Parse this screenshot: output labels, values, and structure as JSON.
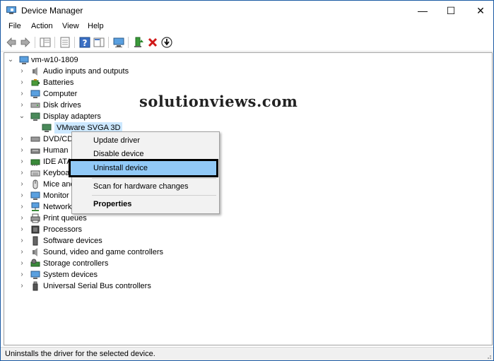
{
  "window": {
    "title": "Device Manager",
    "minimize": "—",
    "maximize": "☐",
    "close": "✕"
  },
  "menu": [
    "File",
    "Action",
    "View",
    "Help"
  ],
  "tree": {
    "root": "vm-w10-1809",
    "items": [
      "Audio inputs and outputs",
      "Batteries",
      "Computer",
      "Disk drives",
      "Display adapters",
      "VMware SVGA 3D",
      "DVD/CD",
      "Human",
      "IDE ATA",
      "Keyboa",
      "Mice and",
      "Monitor",
      "Network",
      "Print queues",
      "Processors",
      "Software devices",
      "Sound, video and game controllers",
      "Storage controllers",
      "System devices",
      "Universal Serial Bus controllers"
    ]
  },
  "context_menu": {
    "items": [
      "Update driver",
      "Disable device",
      "Uninstall device",
      "Scan for hardware changes",
      "Properties"
    ],
    "highlighted": "Uninstall device"
  },
  "watermark": "solutionviews.com",
  "status": "Uninstalls the driver for the selected device.",
  "colors": {
    "selection": "#cce8ff",
    "menu_highlight": "#91c9f7",
    "window_border": "#1b5aa3"
  }
}
